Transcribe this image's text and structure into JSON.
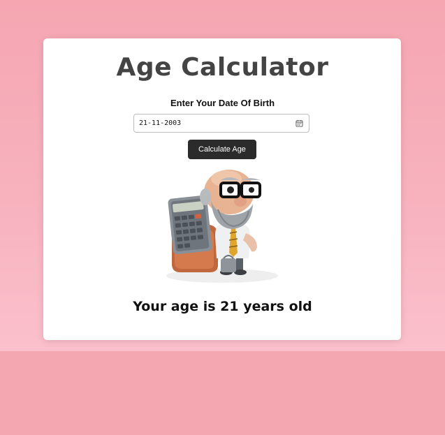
{
  "app": {
    "title": "Age Calculator"
  },
  "form": {
    "label": "Enter Your Date Of Birth",
    "date_value": "21-11-2003",
    "submit_label": "Calculate Age"
  },
  "result": {
    "text": "Your age is 21 years old"
  },
  "colors": {
    "background": "#f4a6b1",
    "card": "#ffffff",
    "button": "#2b2b2b",
    "title": "#444444"
  },
  "icons": {
    "date_picker": "calendar-icon"
  }
}
